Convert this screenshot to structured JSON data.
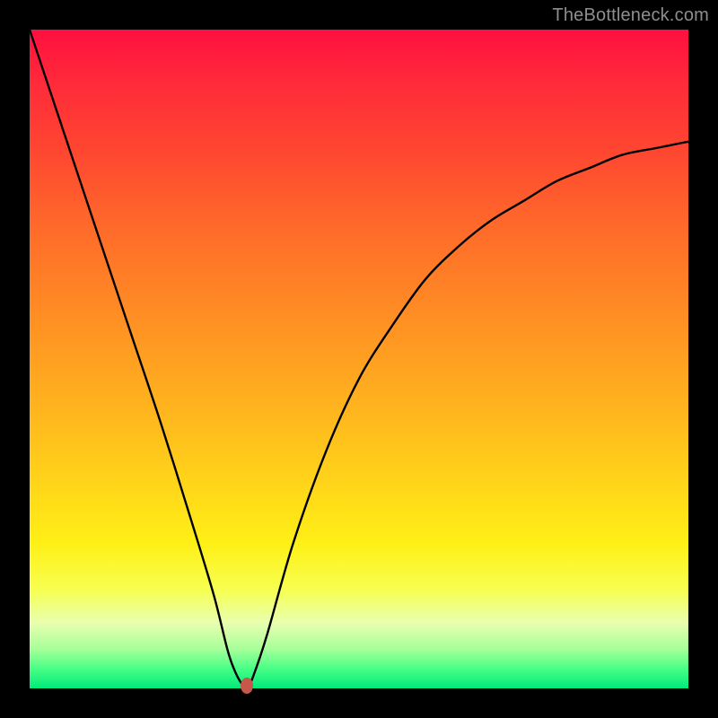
{
  "watermark": "TheBottleneck.com",
  "colors": {
    "frame": "#000000",
    "gradient_top": "#ff103f",
    "gradient_bottom": "#00ea7a",
    "curve": "#000000",
    "marker": "#c5584a"
  },
  "chart_data": {
    "type": "line",
    "title": "",
    "xlabel": "",
    "ylabel": "",
    "xlim": [
      0,
      100
    ],
    "ylim": [
      0,
      100
    ],
    "grid": false,
    "annotations": [
      {
        "type": "marker",
        "x": 33,
        "y": 0,
        "label": "optimal-point"
      }
    ],
    "series": [
      {
        "name": "bottleneck-curve",
        "x": [
          0,
          5,
          10,
          15,
          20,
          25,
          28,
          30,
          31,
          32,
          33,
          34,
          36,
          40,
          45,
          50,
          55,
          60,
          65,
          70,
          75,
          80,
          85,
          90,
          95,
          100
        ],
        "y": [
          100,
          85,
          70,
          55,
          40,
          24,
          14,
          6,
          3,
          1,
          0,
          2,
          8,
          22,
          36,
          47,
          55,
          62,
          67,
          71,
          74,
          77,
          79,
          81,
          82,
          83
        ]
      }
    ]
  }
}
